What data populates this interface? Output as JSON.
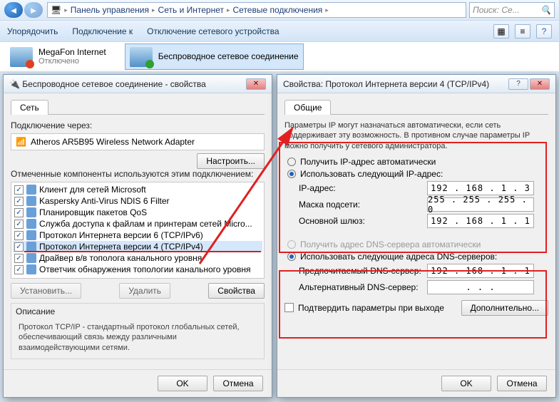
{
  "explorer": {
    "breadcrumb": [
      "Панель управления",
      "Сеть и Интернет",
      "Сетевые подключения"
    ],
    "search_placeholder": "Поиск: Се...",
    "toolbar": {
      "organize": "Упорядочить",
      "connect": "Подключение к",
      "disable": "Отключение сетевого устройства"
    },
    "connections": [
      {
        "name": "MegaFon Internet",
        "status": "Отключено"
      },
      {
        "name": "Беспроводное сетевое соединение",
        "status": ""
      }
    ]
  },
  "left_dialog": {
    "title": "Беспроводное сетевое соединение - свойства",
    "tab": "Сеть",
    "connect_via_label": "Подключение через:",
    "adapter": "Atheros AR5B95 Wireless Network Adapter",
    "configure_btn": "Настроить...",
    "components_label": "Отмеченные компоненты используются этим подключением:",
    "components": [
      "Клиент для сетей Microsoft",
      "Kaspersky Anti-Virus NDIS 6 Filter",
      "Планировщик пакетов QoS",
      "Служба доступа к файлам и принтерам сетей Micro...",
      "Протокол Интернета версии 6 (TCP/IPv6)",
      "Протокол Интернета версии 4 (TCP/IPv4)",
      "Драйвер в/в тополога канального уровня",
      "Ответчик обнаружения топологии канального уровня"
    ],
    "highlight_index": 5,
    "install_btn": "Установить...",
    "remove_btn": "Удалить",
    "props_btn": "Свойства",
    "desc_label": "Описание",
    "desc_text": "Протокол TCP/IP - стандартный протокол глобальных сетей, обеспечивающий связь между различными взаимодействующими сетями.",
    "ok": "OK",
    "cancel": "Отмена"
  },
  "right_dialog": {
    "title": "Свойства: Протокол Интернета версии 4 (TCP/IPv4)",
    "tab": "Общие",
    "intro": "Параметры IP могут назначаться автоматически, если сеть поддерживает эту возможность. В противном случае параметры IP можно получить у сетевого администратора.",
    "radio_auto_ip": "Получить IP-адрес автоматически",
    "radio_manual_ip": "Использовать следующий IP-адрес:",
    "ip_label": "IP-адрес:",
    "ip_value": "192 . 168 .  1  .  3",
    "mask_label": "Маска подсети:",
    "mask_value": "255 . 255 . 255 .  0",
    "gw_label": "Основной шлюз:",
    "gw_value": "192 . 168 .  1  .  1",
    "radio_auto_dns": "Получить адрес DNS-сервера автоматически",
    "radio_manual_dns": "Использовать следующие адреса DNS-серверов:",
    "dns1_label": "Предпочитаемый DNS-сервер:",
    "dns1_value": "192 . 168 .  1  .  1",
    "dns2_label": "Альтернативный DNS-сервер:",
    "dns2_value": " .    .    . ",
    "confirm_exit": "Подтвердить параметры при выходе",
    "advanced": "Дополнительно...",
    "ok": "OK",
    "cancel": "Отмена"
  }
}
